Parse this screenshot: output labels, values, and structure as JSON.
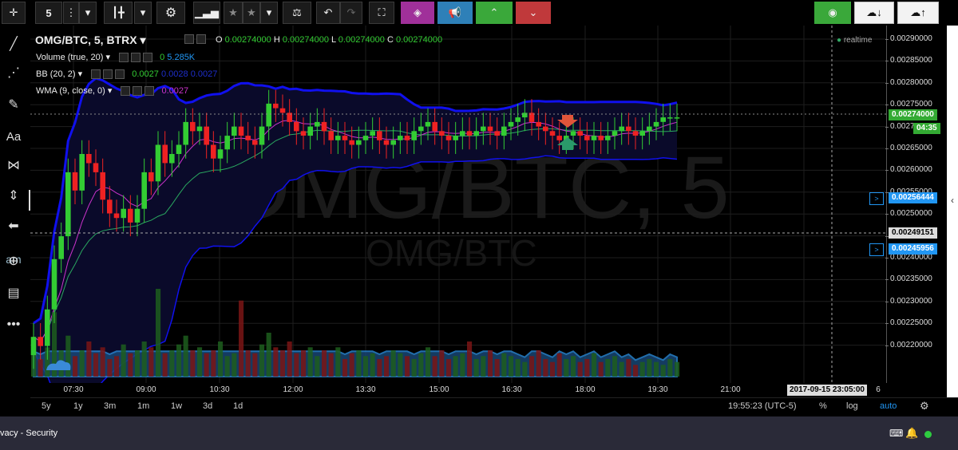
{
  "toolbar": {
    "interval": "5",
    "buttons": [
      "interval",
      "menu",
      "dropdown",
      "candles-icon",
      "chart-type-dropdown",
      "settings-icon",
      "indicators-icon",
      "star-icon",
      "star-icon",
      "dropdown",
      "compare-icon",
      "undo-icon",
      "redo-icon",
      "fullscreen-icon",
      "cube-icon",
      "megaphone-icon",
      "up-icon",
      "down-icon",
      "camera-icon",
      "cloud-download-icon",
      "cloud-upload-icon"
    ]
  },
  "legend": {
    "symbol": "OMG/BTC, 5, BTRX",
    "ohlc": {
      "o_label": "O",
      "o": "0.00274000",
      "h_label": "H",
      "h": "0.00274000",
      "l_label": "L",
      "l": "0.00274000",
      "c_label": "C",
      "c": "0.00274000"
    },
    "volume_label": "Volume (true, 20)",
    "volume_value_prefix": "0",
    "volume_value": "5.285K",
    "bb_label": "BB (20, 2)",
    "bb_values": [
      "0.0027",
      "0.0028",
      "0.0027"
    ],
    "wma_label": "WMA (9, close, 0)",
    "wma_value": "0.0027",
    "realtime": "realtime"
  },
  "watermark": {
    "big": "OMG/BTC, 5",
    "small": "OMG/BTC"
  },
  "left_text": "am",
  "y_axis": {
    "labels": [
      "0.00290000",
      "0.00285000",
      "0.00280000",
      "0.00275000",
      "0.00270000",
      "0.00265000",
      "0.00260000",
      "0.00255000",
      "0.00250000",
      "0.00245000",
      "0.00240000",
      "0.00235000",
      "0.00230000",
      "0.00225000",
      "0.00220000"
    ],
    "current_price": "0.00274000",
    "countdown": "04:35",
    "alert_1": "0.00256444",
    "crosshair": "0.00249151",
    "alert_2": "0.00245956",
    "alert_marker": ">"
  },
  "x_axis": {
    "labels": [
      "07:30",
      "09:00",
      "10:30",
      "12:00",
      "13:30",
      "15:00",
      "16:30",
      "18:00",
      "19:30",
      "21:00",
      "6"
    ],
    "crosshair_time": "2017-09-15 23:05:00"
  },
  "bottom": {
    "ranges": [
      "5y",
      "1y",
      "3m",
      "1m",
      "1w",
      "3d",
      "1d"
    ],
    "clock": "19:55:23 (UTC-5)",
    "percent": "%",
    "log": "log",
    "auto": "auto"
  },
  "taskbar": {
    "text": "vacy - Security"
  },
  "colors": {
    "up": "#33cc33",
    "down": "#ee2222",
    "bb": "#1010ee",
    "wma": "#cc33cc",
    "accent": "#2196f3",
    "tag_green": "#33aa33"
  },
  "chart_data": {
    "type": "candlestick",
    "ylim": [
      0.00218,
      0.00292
    ],
    "close": [
      0.00226,
      0.00224,
      0.00232,
      0.00243,
      0.00248,
      0.00262,
      0.00258,
      0.00266,
      0.00264,
      0.00262,
      0.00256,
      0.00253,
      0.00252,
      0.00254,
      0.00251,
      0.00254,
      0.00262,
      0.0026,
      0.00268,
      0.00264,
      0.00266,
      0.00268,
      0.00273,
      0.00271,
      0.00272,
      0.00268,
      0.00265,
      0.00267,
      0.0027,
      0.00272,
      0.0027,
      0.00269,
      0.00268,
      0.00272,
      0.00277,
      0.00276,
      0.00275,
      0.00273,
      0.00271,
      0.0027,
      0.00272,
      0.00273,
      0.00271,
      0.00269,
      0.0027,
      0.00269,
      0.00268,
      0.00269,
      0.0027,
      0.00271,
      0.00269,
      0.00268,
      0.00269,
      0.0027,
      0.00269,
      0.00271,
      0.00272,
      0.00273,
      0.00271,
      0.0027,
      0.00269,
      0.0027,
      0.00271,
      0.0027,
      0.00271,
      0.00272,
      0.00271,
      0.0027,
      0.00272,
      0.00273,
      0.00274,
      0.00275,
      0.00273,
      0.00272,
      0.00271,
      0.0027,
      0.00269,
      0.0027,
      0.00271,
      0.0027,
      0.00269,
      0.0027,
      0.00269,
      0.0027,
      0.00271,
      0.00272,
      0.00271,
      0.0027,
      0.00271,
      0.00272,
      0.00273,
      0.00274,
      0.00274,
      0.00274
    ],
    "open": [
      0.00222,
      0.00226,
      0.00224,
      0.00232,
      0.00243,
      0.00248,
      0.00262,
      0.00258,
      0.00266,
      0.00264,
      0.00262,
      0.00256,
      0.00253,
      0.00252,
      0.00254,
      0.00251,
      0.00254,
      0.00262,
      0.0026,
      0.00268,
      0.00264,
      0.00266,
      0.00268,
      0.00273,
      0.00271,
      0.00272,
      0.00268,
      0.00265,
      0.00267,
      0.0027,
      0.00272,
      0.0027,
      0.00269,
      0.00268,
      0.00272,
      0.00277,
      0.00276,
      0.00275,
      0.00273,
      0.00271,
      0.0027,
      0.00272,
      0.00273,
      0.00271,
      0.00269,
      0.0027,
      0.00269,
      0.00268,
      0.00269,
      0.0027,
      0.00271,
      0.00269,
      0.00268,
      0.00269,
      0.0027,
      0.00269,
      0.00271,
      0.00272,
      0.00273,
      0.00271,
      0.0027,
      0.00269,
      0.0027,
      0.00271,
      0.0027,
      0.00271,
      0.00272,
      0.00271,
      0.0027,
      0.00272,
      0.00273,
      0.00274,
      0.00275,
      0.00273,
      0.00272,
      0.00271,
      0.0027,
      0.00269,
      0.0027,
      0.00271,
      0.0027,
      0.00269,
      0.0027,
      0.00269,
      0.0027,
      0.00271,
      0.00272,
      0.00271,
      0.0027,
      0.00271,
      0.00272,
      0.00273,
      0.00274,
      0.00274
    ],
    "volume": [
      8,
      6,
      10,
      22,
      9,
      14,
      7,
      9,
      12,
      8,
      10,
      6,
      7,
      11,
      8,
      9,
      12,
      10,
      30,
      8,
      9,
      11,
      14,
      9,
      10,
      8,
      9,
      12,
      7,
      8,
      26,
      9,
      8,
      11,
      15,
      10,
      9,
      12,
      8,
      9,
      10,
      7,
      9,
      8,
      10,
      6,
      8,
      9,
      7,
      8,
      6,
      7,
      9,
      8,
      7,
      6,
      8,
      10,
      7,
      9,
      6,
      7,
      8,
      12,
      6,
      7,
      9,
      6,
      8,
      7,
      6,
      5,
      7,
      9,
      6,
      5,
      8,
      6,
      7,
      5,
      6,
      8,
      5,
      6,
      7,
      5,
      6,
      4,
      5,
      6,
      5,
      4,
      6,
      5
    ]
  }
}
